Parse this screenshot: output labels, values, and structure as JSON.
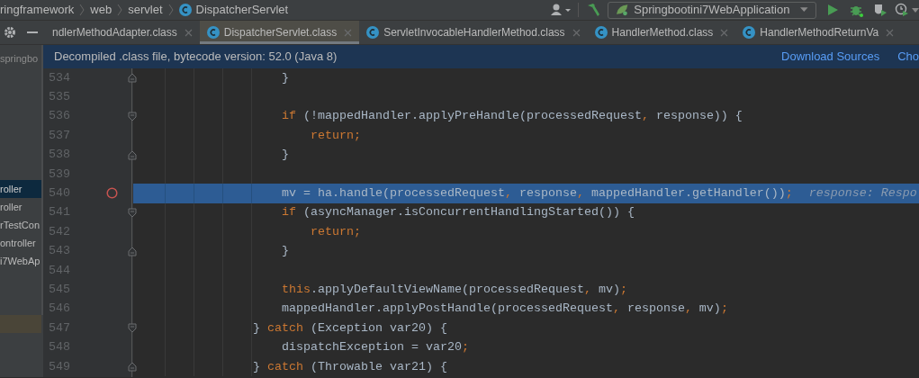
{
  "breadcrumb": [
    "ringframework",
    "web",
    "servlet",
    "DispatcherServlet"
  ],
  "run_config": {
    "label": "Springbootini7WebApplication"
  },
  "tabs": [
    {
      "label": "ndlerMethodAdapter.class",
      "selected": false,
      "icon": false
    },
    {
      "label": "DispatcherServlet.class",
      "selected": true,
      "icon": true
    },
    {
      "label": "ServletInvocableHandlerMethod.class",
      "selected": false,
      "icon": true
    },
    {
      "label": "HandlerMethod.class",
      "selected": false,
      "icon": true
    },
    {
      "label": "HandlerMethodReturnVa",
      "selected": false,
      "icon": true
    }
  ],
  "project": {
    "header": "springbo",
    "items": [
      {
        "label": "roller",
        "selected": true
      },
      {
        "label": "roller",
        "selected": false
      },
      {
        "label": "rTestCon",
        "selected": false
      },
      {
        "label": "ontroller",
        "selected": false
      },
      {
        "label": "i7WebAp",
        "selected": false
      }
    ]
  },
  "notice": {
    "text": "Decompiled .class file, bytecode version: 52.0 (Java 8)",
    "links": [
      "Download Sources",
      "Cho"
    ]
  },
  "lines": [
    {
      "number": "534",
      "current": false,
      "breakpoint": false,
      "fold_start": false,
      "fold_end": true,
      "tokens": [
        {
          "kind": "text",
          "text": "                    }"
        }
      ]
    },
    {
      "number": "535",
      "current": false,
      "breakpoint": false,
      "fold_start": false,
      "fold_end": false
    },
    {
      "number": "536",
      "current": false,
      "breakpoint": false,
      "fold_start": true,
      "fold_end": false,
      "tokens": [
        {
          "kind": "keyword",
          "text": "                    if"
        },
        {
          "kind": "text",
          "text": " (!mappedHandler.applyPreHandle(processedRequest"
        },
        {
          "kind": "keyword",
          "text": ","
        },
        {
          "kind": "text",
          "text": " response)) {"
        }
      ]
    },
    {
      "number": "537",
      "current": false,
      "breakpoint": false,
      "fold_start": false,
      "fold_end": false,
      "tokens": [
        {
          "kind": "keyword",
          "text": "                        return;"
        }
      ]
    },
    {
      "number": "538",
      "current": false,
      "breakpoint": false,
      "fold_start": false,
      "fold_end": true,
      "tokens": [
        {
          "kind": "text",
          "text": "                    }"
        }
      ]
    },
    {
      "number": "539",
      "current": false,
      "breakpoint": false,
      "fold_start": false,
      "fold_end": false
    },
    {
      "number": "540",
      "current": true,
      "breakpoint": true,
      "fold_start": false,
      "fold_end": false,
      "tokens": [
        {
          "kind": "text",
          "text": "                    mv = ha.handle(processedRequest"
        },
        {
          "kind": "keyword",
          "text": ","
        },
        {
          "kind": "text",
          "text": " response"
        },
        {
          "kind": "keyword",
          "text": ","
        },
        {
          "kind": "text",
          "text": " mappedHandler.getHandler())"
        },
        {
          "kind": "keyword",
          "text": ";"
        }
      ],
      "hint": "response: Respo"
    },
    {
      "number": "541",
      "current": false,
      "breakpoint": false,
      "fold_start": true,
      "fold_end": false,
      "tokens": [
        {
          "kind": "keyword",
          "text": "                    if"
        },
        {
          "kind": "text",
          "text": " (asyncManager.isConcurrentHandlingStarted()) {"
        }
      ]
    },
    {
      "number": "542",
      "current": false,
      "breakpoint": false,
      "fold_start": false,
      "fold_end": false,
      "tokens": [
        {
          "kind": "keyword",
          "text": "                        return;"
        }
      ]
    },
    {
      "number": "543",
      "current": false,
      "breakpoint": false,
      "fold_start": false,
      "fold_end": true,
      "tokens": [
        {
          "kind": "text",
          "text": "                    }"
        }
      ]
    },
    {
      "number": "544",
      "current": false,
      "breakpoint": false,
      "fold_start": false,
      "fold_end": false
    },
    {
      "number": "545",
      "current": false,
      "breakpoint": false,
      "fold_start": false,
      "fold_end": false,
      "tokens": [
        {
          "kind": "keyword",
          "text": "                    this"
        },
        {
          "kind": "text",
          "text": ".applyDefaultViewName(processedRequest"
        },
        {
          "kind": "keyword",
          "text": ","
        },
        {
          "kind": "text",
          "text": " mv)"
        },
        {
          "kind": "keyword",
          "text": ";"
        }
      ]
    },
    {
      "number": "546",
      "current": false,
      "breakpoint": false,
      "fold_start": false,
      "fold_end": false,
      "tokens": [
        {
          "kind": "text",
          "text": "                    mappedHandler.applyPostHandle(processedRequest"
        },
        {
          "kind": "keyword",
          "text": ","
        },
        {
          "kind": "text",
          "text": " response"
        },
        {
          "kind": "keyword",
          "text": ","
        },
        {
          "kind": "text",
          "text": " mv)"
        },
        {
          "kind": "keyword",
          "text": ";"
        }
      ]
    },
    {
      "number": "547",
      "current": false,
      "breakpoint": false,
      "fold_start": true,
      "fold_end": false,
      "tokens": [
        {
          "kind": "text",
          "text": "                } "
        },
        {
          "kind": "keyword",
          "text": "catch"
        },
        {
          "kind": "text",
          "text": " (Exception var20) {"
        }
      ]
    },
    {
      "number": "548",
      "current": false,
      "breakpoint": false,
      "fold_start": false,
      "fold_end": false,
      "tokens": [
        {
          "kind": "text",
          "text": "                    dispatchException = var20"
        },
        {
          "kind": "keyword",
          "text": ";"
        }
      ]
    },
    {
      "number": "549",
      "current": false,
      "breakpoint": false,
      "fold_start": false,
      "fold_end": true,
      "tokens": [
        {
          "kind": "text",
          "text": "                } "
        },
        {
          "kind": "keyword",
          "text": "catch"
        },
        {
          "kind": "text",
          "text": " (Throwable var21) {"
        }
      ]
    }
  ]
}
